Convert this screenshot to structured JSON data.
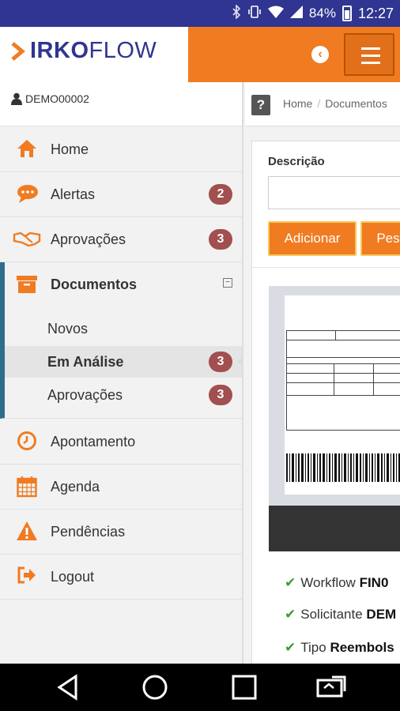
{
  "status_bar": {
    "battery": "84%",
    "time": "12:27"
  },
  "header": {
    "logo_part1": "IRKO",
    "logo_part2": "FLOW",
    "menu_icon": "hamburger-icon",
    "back_icon": "chevron-left-circle-icon"
  },
  "sidebar": {
    "user": "DEMO00002",
    "items": [
      {
        "label": "Home",
        "icon": "home-icon"
      },
      {
        "label": "Alertas",
        "icon": "chat-icon",
        "badge": "2"
      },
      {
        "label": "Aprovações",
        "icon": "handshake-icon",
        "badge": "3"
      },
      {
        "label": "Documentos",
        "icon": "archive-icon"
      },
      {
        "label": "Apontamento",
        "icon": "clock-icon"
      },
      {
        "label": "Agenda",
        "icon": "calendar-icon"
      },
      {
        "label": "Pendências",
        "icon": "warning-icon"
      },
      {
        "label": "Logout",
        "icon": "logout-icon"
      }
    ],
    "documentos_sub": [
      {
        "label": "Novos"
      },
      {
        "label": "Em Análise",
        "badge": "3"
      },
      {
        "label": "Aprovações",
        "badge": "3"
      }
    ],
    "collapse_symbol": "−"
  },
  "content": {
    "help_symbol": "?",
    "breadcrumb": [
      "Home",
      "Documentos"
    ],
    "breadcrumb_sep": "/",
    "description_label": "Descrição",
    "add_button": "Adicionar",
    "search_button": "Pes",
    "details": [
      {
        "prefix": "Workflow",
        "value": "FIN0"
      },
      {
        "prefix": "Solicitante",
        "value": "DEM"
      },
      {
        "prefix": "Tipo",
        "value": "Reembols"
      }
    ]
  },
  "colors": {
    "accent": "#f07b21",
    "brand_blue": "#2f3590",
    "badge": "#a14f4f",
    "active_bar": "#2f6e8a"
  }
}
